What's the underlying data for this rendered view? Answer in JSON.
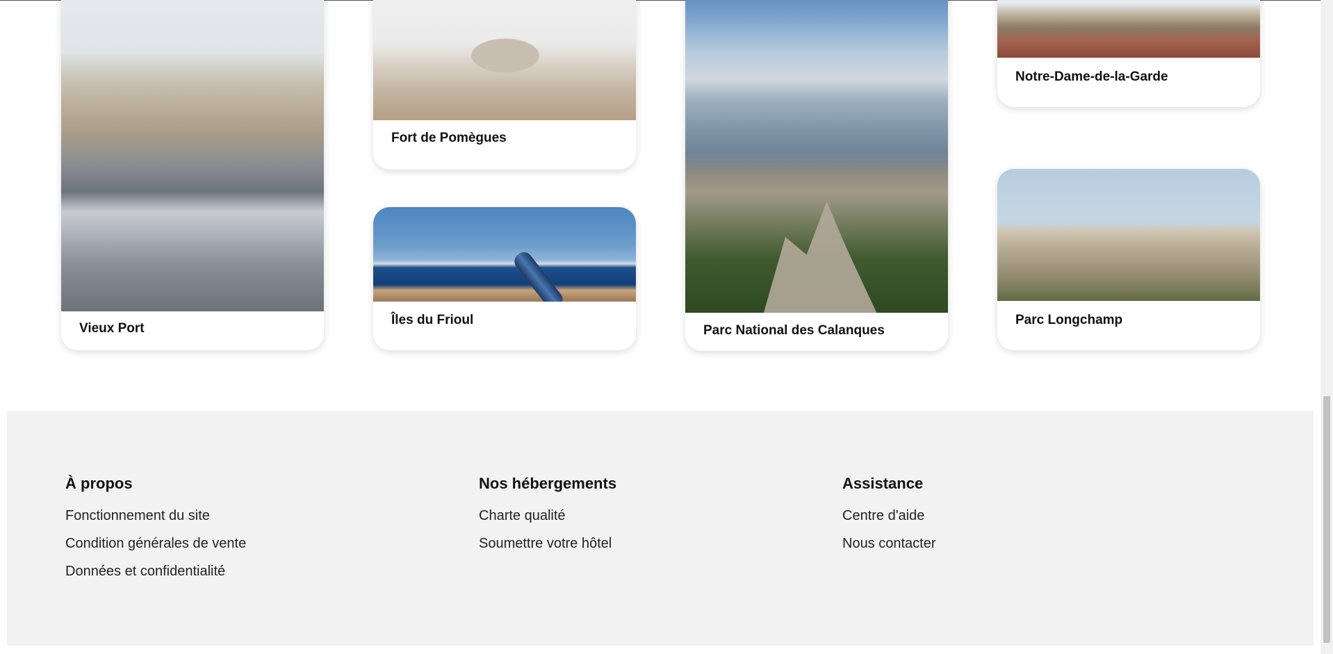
{
  "cards": [
    {
      "label": "Vieux Port"
    },
    {
      "label": "Fort de Pomègues"
    },
    {
      "label": "Îles du Frioul"
    },
    {
      "label": "Parc National des Calanques"
    },
    {
      "label": "Notre-Dame-de-la-Garde"
    },
    {
      "label": "Parc Longchamp"
    }
  ],
  "footer": {
    "about": {
      "title": "À propos",
      "links": [
        "Fonctionnement du site",
        "Condition générales de vente",
        "Données et confidentialité"
      ]
    },
    "lodging": {
      "title": "Nos hébergements",
      "links": [
        "Charte qualité",
        "Soumettre votre hôtel"
      ]
    },
    "support": {
      "title": "Assistance",
      "links": [
        "Centre d'aide",
        "Nous contacter"
      ]
    }
  },
  "colors": {
    "footer_bg": "#f2f2f2",
    "card_bg": "#ffffff",
    "text": "#111111"
  }
}
